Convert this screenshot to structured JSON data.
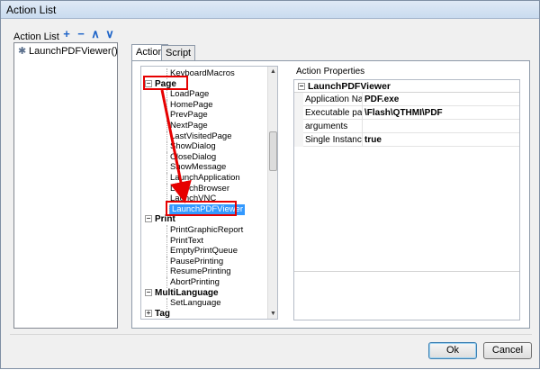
{
  "window": {
    "title": "Action List"
  },
  "action_list": {
    "label": "Action List",
    "tool_icons": [
      "plus-icon",
      "minus-icon",
      "chevron-up-icon",
      "chevron-down-icon"
    ],
    "items": [
      "LaunchPDFViewer()"
    ]
  },
  "tabs": [
    "Action",
    "Script"
  ],
  "tree": {
    "rows": [
      {
        "text": "KeyboardMacros",
        "kind": "leaf"
      },
      {
        "text": "Page",
        "kind": "cat",
        "expander": "⊟"
      },
      {
        "text": "LoadPage",
        "kind": "leaf"
      },
      {
        "text": "HomePage",
        "kind": "leaf"
      },
      {
        "text": "PrevPage",
        "kind": "leaf"
      },
      {
        "text": "NextPage",
        "kind": "leaf"
      },
      {
        "text": "LastVisitedPage",
        "kind": "leaf"
      },
      {
        "text": "ShowDialog",
        "kind": "leaf"
      },
      {
        "text": "CloseDialog",
        "kind": "leaf"
      },
      {
        "text": "ShowMessage",
        "kind": "leaf"
      },
      {
        "text": "LaunchApplication",
        "kind": "leaf"
      },
      {
        "text": "LaunchBrowser",
        "kind": "leaf"
      },
      {
        "text": "LaunchVNC",
        "kind": "leaf"
      },
      {
        "text": "LaunchPDFViewer",
        "kind": "leaf",
        "selected": true
      },
      {
        "text": "Print",
        "kind": "cat",
        "expander": "⊟"
      },
      {
        "text": "PrintGraphicReport",
        "kind": "leaf"
      },
      {
        "text": "PrintText",
        "kind": "leaf"
      },
      {
        "text": "EmptyPrintQueue",
        "kind": "leaf"
      },
      {
        "text": "PausePrinting",
        "kind": "leaf"
      },
      {
        "text": "ResumePrinting",
        "kind": "leaf"
      },
      {
        "text": "AbortPrinting",
        "kind": "leaf"
      },
      {
        "text": "MultiLanguage",
        "kind": "cat",
        "expander": "⊟"
      },
      {
        "text": "SetLanguage",
        "kind": "leaf"
      },
      {
        "text": "Tag",
        "kind": "cat",
        "expander": "⊞"
      }
    ]
  },
  "properties": {
    "label": "Action Properties",
    "group": "LaunchPDFViewer",
    "rows": [
      {
        "name": "Application Name",
        "value": "PDF.exe"
      },
      {
        "name": "Executable path",
        "value": "\\Flash\\QTHMI\\PDF"
      },
      {
        "name": "arguments",
        "value": ""
      },
      {
        "name": "Single Instance",
        "value": "true"
      }
    ]
  },
  "buttons": {
    "ok": "Ok",
    "cancel": "Cancel"
  },
  "annotation_color": "#e60000"
}
